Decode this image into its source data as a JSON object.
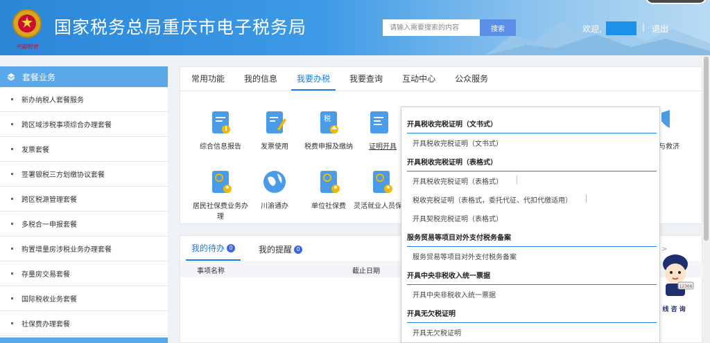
{
  "header": {
    "title": "国家税务总局重庆市电子税务局",
    "search_placeholder": "请输入需要搜索的内容",
    "search_button": "搜索",
    "welcome": "欢迎,",
    "separator": "|",
    "logout": "退出"
  },
  "sidebar": {
    "title": "套餐业务",
    "items": [
      {
        "label": "新办纳税人套餐服务"
      },
      {
        "label": "跨区域涉税事项综合办理套餐"
      },
      {
        "label": "发票套餐"
      },
      {
        "label": "签署银税三方划缴协议套餐"
      },
      {
        "label": "跨区税源管理套餐"
      },
      {
        "label": "多税合一申报套餐"
      },
      {
        "label": "购置增量房涉税业务办理套餐"
      },
      {
        "label": "存量房交易套餐"
      },
      {
        "label": "国际税收业务套餐"
      },
      {
        "label": "社保费办理套餐"
      }
    ]
  },
  "main": {
    "tabs": [
      "常用功能",
      "我的信息",
      "我要办税",
      "我要查询",
      "互动中心",
      "公众服务"
    ],
    "active_tab": "我要办税",
    "tiles": [
      {
        "label": "综合信息报告"
      },
      {
        "label": "发票使用"
      },
      {
        "label": "税费申报及缴纳"
      },
      {
        "label": "证明开具"
      },
      {
        "label": "与救济"
      },
      {
        "label": "居民社保费业务办理"
      },
      {
        "label": "川渝通办"
      },
      {
        "label": "单位社保费"
      },
      {
        "label": "灵活就业人员保费"
      }
    ],
    "tile_extra_glyph": "税"
  },
  "todo": {
    "tabs": [
      {
        "label": "我的待办",
        "count": "0"
      },
      {
        "label": "我的提醒",
        "count": "0"
      }
    ],
    "columns": [
      "事项名称",
      "截止日期"
    ],
    "arrow": ">"
  },
  "mascot": {
    "text": "线 咨 询",
    "number": "12366"
  },
  "dropdown": {
    "groups": [
      {
        "title": "开具税收完税证明（文书式）",
        "items": [
          "开具税收完税证明（文书式）"
        ]
      },
      {
        "title": "开具税收完税证明（表格式）",
        "items": [
          "开具税收完税证明（表格式）",
          "税收完税证明（表格式，委托代征、代扣代缴适用）",
          "开具契税完税证明（表格式）"
        ]
      },
      {
        "title": "服务贸易等项目对外支付税务备案",
        "items": [
          "服务贸易等项目对外支付税务备案"
        ]
      },
      {
        "title": "开具中央非税收入统一票据",
        "items": [
          "开具中央非税收入统一票据"
        ]
      },
      {
        "title": "开具无欠税证明",
        "items": [
          "开具无欠税证明"
        ]
      }
    ]
  },
  "colors": {
    "accent": "#1a7be0",
    "header": "#2b86d8",
    "sidebar_head": "#5aa7e9"
  }
}
